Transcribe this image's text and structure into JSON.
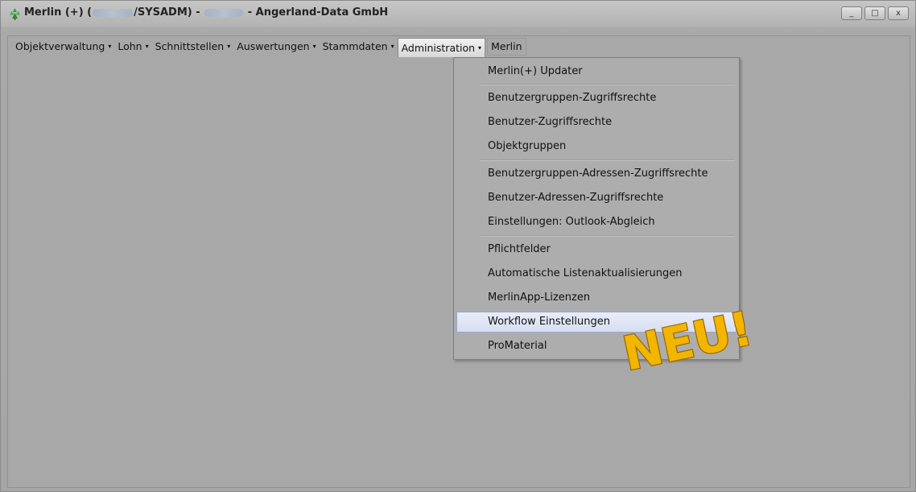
{
  "window": {
    "title_parts": [
      "Merlin (+) (",
      "/SYSADM) - ",
      " - Angerland-Data GmbH"
    ],
    "controls": {
      "minimize": "_",
      "maximize": "□",
      "close": "x"
    }
  },
  "menubar": {
    "items": [
      {
        "label": "Objektverwaltung",
        "caret": "▾"
      },
      {
        "label": "Lohn",
        "caret": "▾"
      },
      {
        "label": "Schnittstellen",
        "caret": "▾"
      },
      {
        "label": "Auswertungen",
        "caret": "▾"
      },
      {
        "label": "Stammdaten",
        "caret": "▾"
      },
      {
        "label": "Administration",
        "caret": "▾"
      },
      {
        "label": "Merlin"
      }
    ]
  },
  "dropdown": {
    "items": [
      {
        "label": "Merlin(+) Updater"
      },
      {
        "label": "Benutzergruppen-Zugriffsrechte"
      },
      {
        "label": "Benutzer-Zugriffsrechte"
      },
      {
        "label": "Objektgruppen"
      },
      {
        "label": "Benutzergruppen-Adressen-Zugriffsrechte"
      },
      {
        "label": "Benutzer-Adressen-Zugriffsrechte"
      },
      {
        "label": "Einstellungen: Outlook-Abgleich"
      },
      {
        "label": "Pflichtfelder"
      },
      {
        "label": "Automatische Listenaktualisierungen"
      },
      {
        "label": "MerlinApp-Lizenzen"
      },
      {
        "label": "Workflow Einstellungen"
      },
      {
        "label": "ProMaterial"
      }
    ],
    "highlighted": "Workflow Einstellungen"
  },
  "badge": {
    "text": "NEU!",
    "color": "#f2b600"
  }
}
